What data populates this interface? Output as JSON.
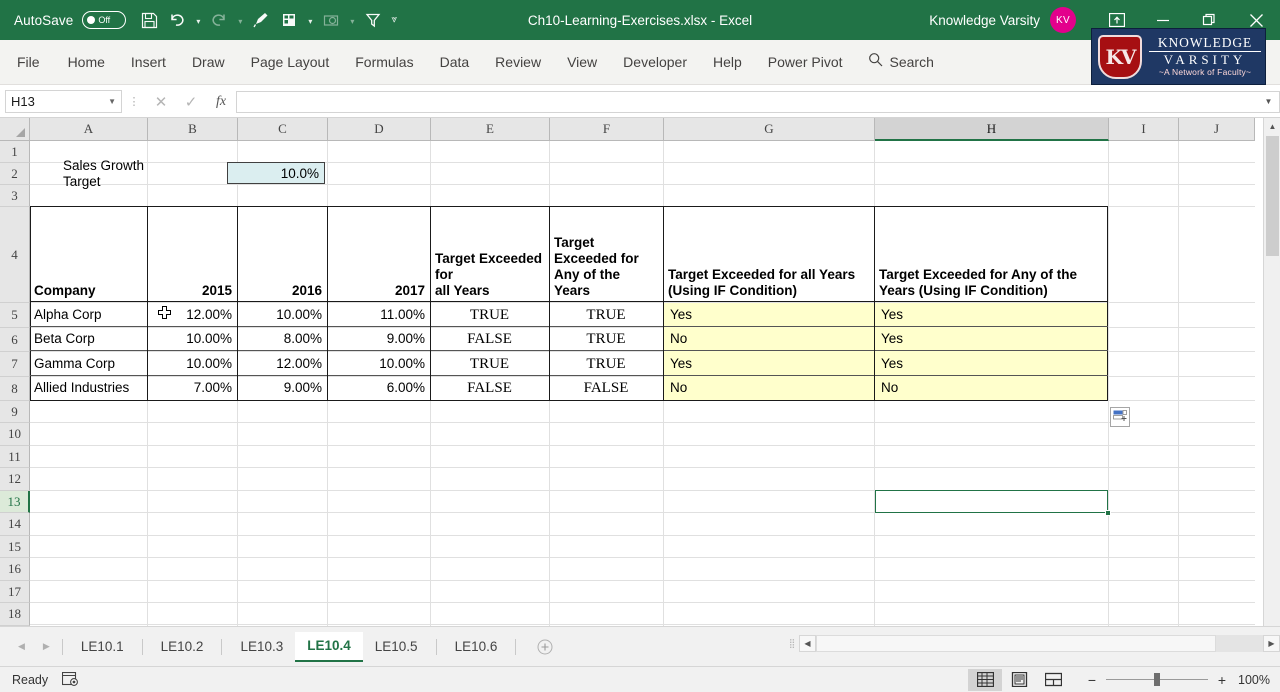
{
  "titlebar": {
    "autosave_label": "AutoSave",
    "autosave_state": "Off",
    "document_title": "Ch10-Learning-Exercises.xlsx  -  Excel",
    "user_name": "Knowledge Varsity",
    "avatar_initials": "KV",
    "qat_items": [
      "save-icon",
      "undo-icon",
      "redo-icon",
      "format-painter-icon",
      "new-comment-icon",
      "camera-icon",
      "filter-icon",
      "customize-qat-icon"
    ],
    "window_buttons": [
      "ribbon-display-options",
      "minimize",
      "restore",
      "close"
    ]
  },
  "ribbon": {
    "tabs": [
      "File",
      "Home",
      "Insert",
      "Draw",
      "Page Layout",
      "Formulas",
      "Data",
      "Review",
      "View",
      "Developer",
      "Help",
      "Power Pivot"
    ],
    "search_label": "Search"
  },
  "logo": {
    "shield_text": "KV",
    "line1": "KNOWLEDGE",
    "line2": "VARSITY",
    "tagline": "~A Network of Faculty~",
    "banner_color": "#1f3864",
    "shield_color": "#a60f12"
  },
  "formula_bar": {
    "name_box": "H13",
    "cancel_icon": "cancel-icon",
    "enter_icon": "confirm-icon",
    "function_icon": "insert-function-icon",
    "formula_value": ""
  },
  "grid": {
    "columns": [
      "A",
      "B",
      "C",
      "D",
      "E",
      "F",
      "G",
      "H",
      "I",
      "J"
    ],
    "selected_column": "H",
    "rows": [
      "1",
      "2",
      "3",
      "4",
      "5",
      "6",
      "7",
      "8",
      "9",
      "10",
      "11",
      "12",
      "13",
      "14",
      "15",
      "16",
      "17",
      "18"
    ],
    "selected_row": "13",
    "selected_cell": "H13",
    "target_label": "Sales Growth Target",
    "target_value": "10.0%",
    "target_fill": "#dbeef0",
    "highlight_fill": "#ffffcc"
  },
  "table": {
    "headers": {
      "company": "Company",
      "y2015": "2015",
      "y2016": "2016",
      "y2017": "2017",
      "all_years": "Target Exceeded for\nall Years",
      "any_years": "Target\nExceeded for\nAny of the\nYears",
      "all_years_if": "Target Exceeded for all Years\n(Using IF Condition)",
      "any_years_if": "Target Exceeded for Any of the\nYears (Using IF Condition)"
    },
    "rows": [
      {
        "company": "Alpha Corp",
        "y2015": "12.00%",
        "y2016": "10.00%",
        "y2017": "11.00%",
        "all_years": "TRUE",
        "any_years": "TRUE",
        "all_years_if": "Yes",
        "any_years_if": "Yes"
      },
      {
        "company": "Beta Corp",
        "y2015": "10.00%",
        "y2016": "8.00%",
        "y2017": "9.00%",
        "all_years": "FALSE",
        "any_years": "TRUE",
        "all_years_if": "No",
        "any_years_if": "Yes"
      },
      {
        "company": "Gamma Corp",
        "y2015": "10.00%",
        "y2016": "12.00%",
        "y2017": "10.00%",
        "all_years": "TRUE",
        "any_years": "TRUE",
        "all_years_if": "Yes",
        "any_years_if": "Yes"
      },
      {
        "company": "Allied Industries",
        "y2015": "7.00%",
        "y2016": "9.00%",
        "y2017": "6.00%",
        "all_years": "FALSE",
        "any_years": "FALSE",
        "all_years_if": "No",
        "any_years_if": "No"
      }
    ]
  },
  "sheet_tabs": {
    "tabs": [
      "LE10.1",
      "LE10.2",
      "LE10.3",
      "LE10.4",
      "LE10.5",
      "LE10.6"
    ],
    "active": "LE10.4",
    "add_sheet_label": "+"
  },
  "status_bar": {
    "status": "Ready",
    "macro_icon": "record-macro-icon",
    "views": [
      "normal-view",
      "page-layout-view",
      "page-break-preview"
    ],
    "active_view": "normal-view",
    "zoom_out": "−",
    "zoom_in": "+",
    "zoom_level": "100%"
  }
}
